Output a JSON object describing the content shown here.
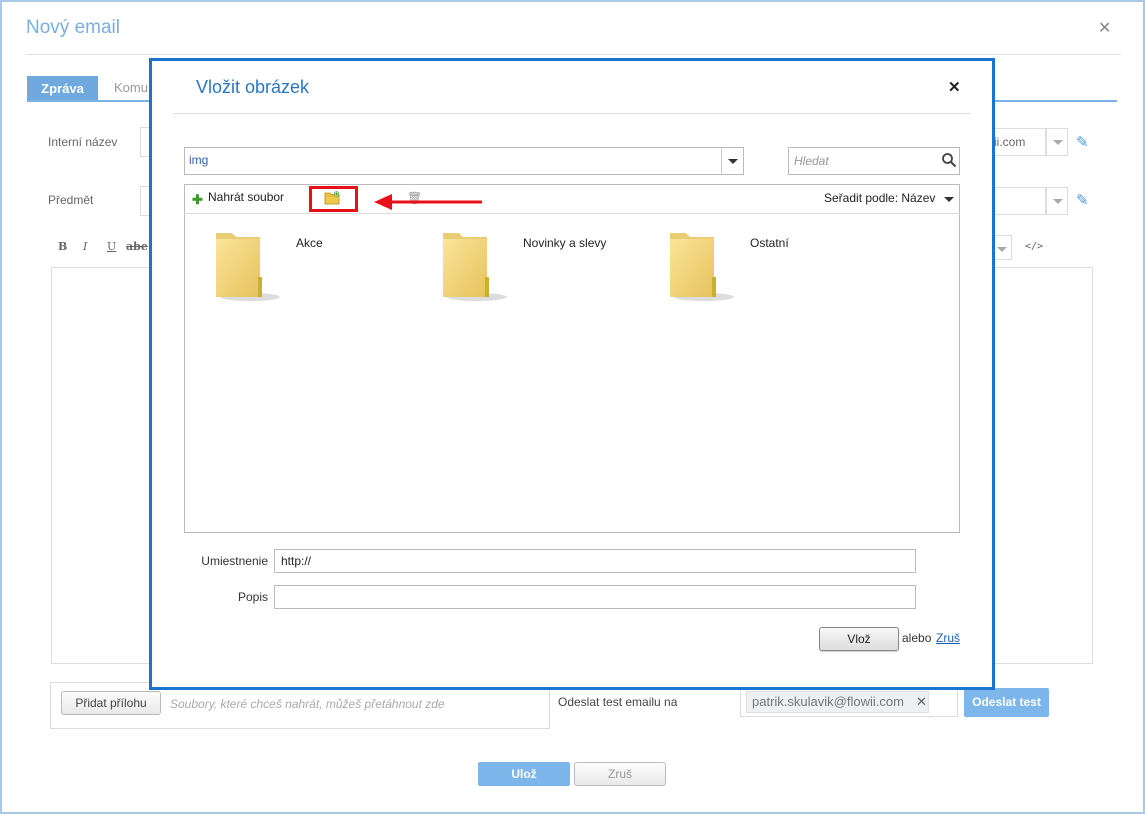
{
  "outer": {
    "title": "Nový email",
    "tabs": [
      "Zpráva",
      "Komu"
    ],
    "internal_name_label": "Interní název",
    "subject_label": "Předmět",
    "sender_partial": "ii.com",
    "format": {
      "bold": "B",
      "italic": "I",
      "underline": "U",
      "strike": "abe",
      "source": "</>"
    },
    "attach_button": "Přidat přílohu",
    "attach_hint": "Soubory, které chceš nahrát, můžeš přetáhnout zde",
    "test_label": "Odeslat test emailu na",
    "test_email": "patrik.skulavik@flowii.com",
    "send_test": "Odeslat test",
    "save": "Ulož",
    "cancel": "Zruš"
  },
  "modal": {
    "title": "Vložit obrázek",
    "path_value": "img",
    "search_placeholder": "Hledat",
    "upload_label": "Nahrát soubor",
    "sort_label": "Seřadit podle: Název",
    "folders": [
      "Akce",
      "Novinky a slevy",
      "Ostatní"
    ],
    "location_label": "Umiestnenie",
    "location_value": "http://",
    "description_label": "Popis",
    "description_value": "",
    "insert_button": "Vlož",
    "or_text": "alebo",
    "cancel_link": "Zruš"
  },
  "colors": {
    "accent": "#1b74cf",
    "highlight": "#e8101b",
    "tab_active": "#6fa9e0"
  }
}
